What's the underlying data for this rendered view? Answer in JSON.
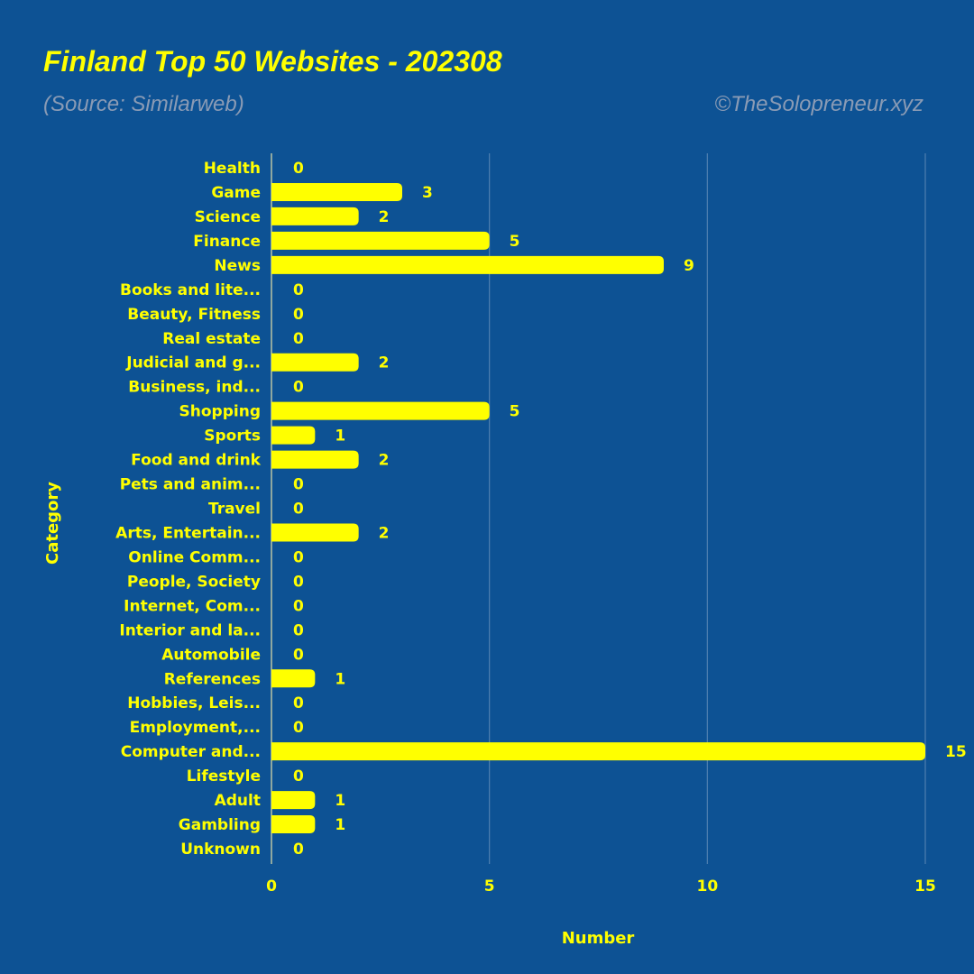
{
  "chart_data": {
    "type": "bar",
    "orientation": "horizontal",
    "title": "Finland Top 50 Websites - 202308",
    "subtitle": "(Source: Similarweb)",
    "credit": "©TheSolopreneur.xyz",
    "xlabel": "Number",
    "ylabel": "Category",
    "xlim": [
      0,
      15
    ],
    "xticks": [
      0,
      5,
      10,
      15
    ],
    "grid": true,
    "categories": [
      "Health",
      "Game",
      "Science",
      "Finance",
      "News",
      "Books and lite...",
      "Beauty, Fitness",
      "Real estate",
      "Judicial and g...",
      "Business, ind...",
      "Shopping",
      "Sports",
      "Food and drink",
      "Pets and anim...",
      "Travel",
      "Arts, Entertain...",
      "Online Comm...",
      "People, Society",
      "Internet, Com...",
      "Interior and la...",
      "Automobile",
      "References",
      "Hobbies, Leis...",
      "Employment,...",
      "Computer and...",
      "Lifestyle",
      "Adult",
      "Gambling",
      "Unknown"
    ],
    "values": [
      0,
      3,
      2,
      5,
      9,
      0,
      0,
      0,
      2,
      0,
      5,
      1,
      2,
      0,
      0,
      2,
      0,
      0,
      0,
      0,
      0,
      1,
      0,
      0,
      15,
      0,
      1,
      1,
      0
    ],
    "colors": {
      "background": "#0d5294",
      "bar": "#ffff00",
      "text": "#ffff00",
      "subtitle": "#8a9bb5",
      "grid": "#4f7fb0"
    }
  }
}
